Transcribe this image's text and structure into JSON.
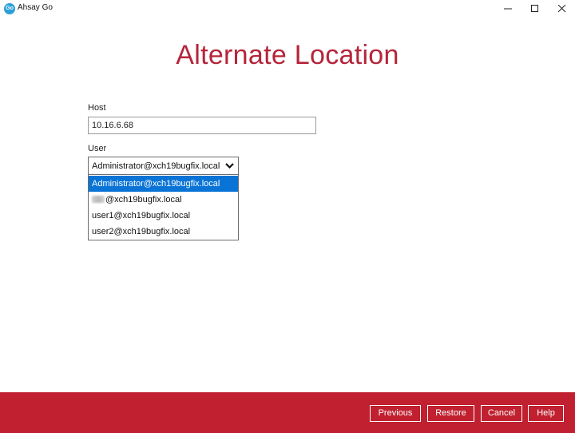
{
  "window": {
    "app_icon_text": "Go",
    "title": "Ahsay Go"
  },
  "page": {
    "title": "Alternate Location"
  },
  "host": {
    "label": "Host",
    "value": "10.16.6.68"
  },
  "user": {
    "label": "User",
    "selected": "Administrator@xch19bugfix.local",
    "options": [
      "Administrator@xch19bugfix.local",
      "@xch19bugfix.local",
      "user1@xch19bugfix.local",
      "user2@xch19bugfix.local"
    ]
  },
  "footer": {
    "previous_label": "Previous",
    "restore_label": "Restore",
    "cancel_label": "Cancel",
    "help_label": "Help"
  },
  "colors": {
    "accent": "#c0202f",
    "title_text": "#b5253a",
    "selection": "#0a74d6"
  }
}
